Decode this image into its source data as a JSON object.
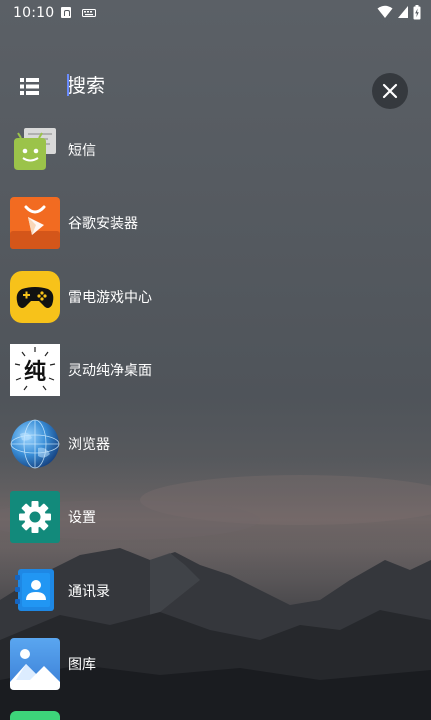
{
  "status_bar": {
    "time": "10:10"
  },
  "search": {
    "placeholder": "搜索"
  },
  "apps": [
    {
      "label": "短信",
      "icon": "sms-icon"
    },
    {
      "label": "谷歌安装器",
      "icon": "google-installer-icon"
    },
    {
      "label": "雷电游戏中心",
      "icon": "game-center-icon"
    },
    {
      "label": "灵动纯净桌面",
      "icon": "launcher-icon",
      "icon_text": "纯"
    },
    {
      "label": "浏览器",
      "icon": "browser-icon"
    },
    {
      "label": "设置",
      "icon": "settings-icon"
    },
    {
      "label": "通讯录",
      "icon": "contacts-icon"
    },
    {
      "label": "图库",
      "icon": "gallery-icon"
    }
  ],
  "colors": {
    "sms": "#9bc34a",
    "google_installer": "#f26b21",
    "game_center": "#f7c21a",
    "settings": "#128a7b",
    "contacts": "#2196f3",
    "gallery": "#4a90e2"
  }
}
